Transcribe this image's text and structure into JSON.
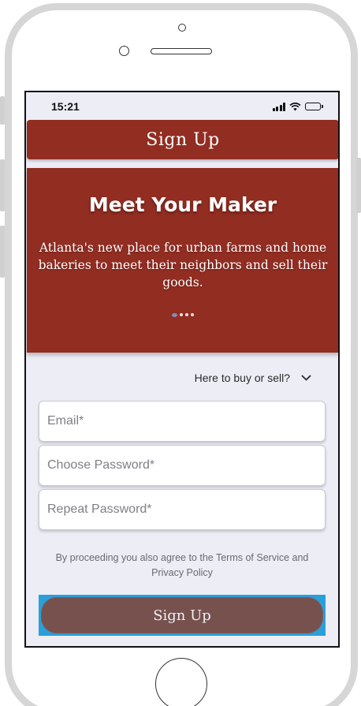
{
  "status_bar": {
    "time": "15:21"
  },
  "header": {
    "title": "Sign Up"
  },
  "hero": {
    "title": "Meet Your Maker",
    "text": "Atlanta's new place for urban farms and home bakeries to meet their neighbors and sell their goods.",
    "dots_total": 4,
    "active_dot": 0
  },
  "role_select": {
    "label": "Here to buy or sell?"
  },
  "form": {
    "email_placeholder": "Email*",
    "password_placeholder": "Choose Password*",
    "repeat_password_placeholder": "Repeat Password*",
    "terms_text": "By proceeding you also agree to the Terms of Service and Privacy Policy",
    "submit_label": "Sign Up"
  },
  "colors": {
    "brand_red": "#922d22",
    "button_brown": "#77514d",
    "focus_blue": "#2a9fd9",
    "background": "#ecedf5"
  },
  "icons": {
    "signal": "cellular-signal-icon",
    "wifi": "wifi-icon",
    "battery": "battery-icon",
    "chevron": "chevron-down-icon"
  }
}
